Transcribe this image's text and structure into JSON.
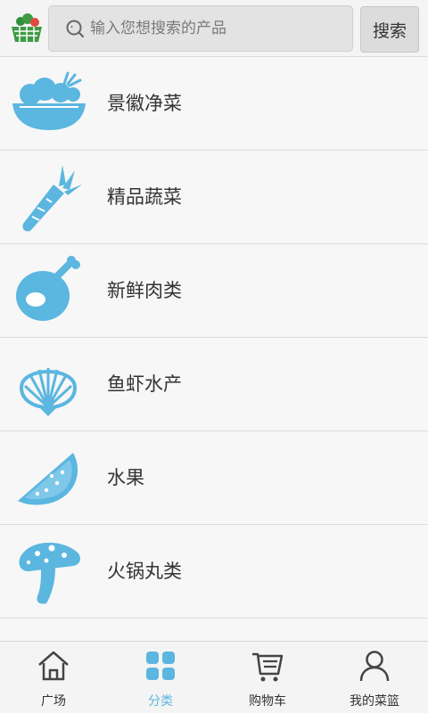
{
  "colors": {
    "accent": "#5bb6e0",
    "logo_green": "#3f9a45"
  },
  "header": {
    "logo_icon": "basket-logo-icon",
    "search": {
      "placeholder": "输入您想搜索的产品",
      "value": ""
    },
    "search_button": "搜索"
  },
  "categories": [
    {
      "label": "景徽净菜",
      "icon": "vegetable-bowl-icon"
    },
    {
      "label": "精品蔬菜",
      "icon": "carrot-icon"
    },
    {
      "label": "新鲜肉类",
      "icon": "ham-icon"
    },
    {
      "label": "鱼虾水产",
      "icon": "shell-icon"
    },
    {
      "label": "水果",
      "icon": "watermelon-icon"
    },
    {
      "label": "火锅丸类",
      "icon": "mushroom-icon"
    }
  ],
  "tabbar": {
    "active": 1,
    "tabs": [
      {
        "label": "广场",
        "icon": "home-icon"
      },
      {
        "label": "分类",
        "icon": "grid-icon"
      },
      {
        "label": "购物车",
        "icon": "cart-icon"
      },
      {
        "label": "我的菜篮",
        "icon": "user-icon"
      }
    ]
  }
}
